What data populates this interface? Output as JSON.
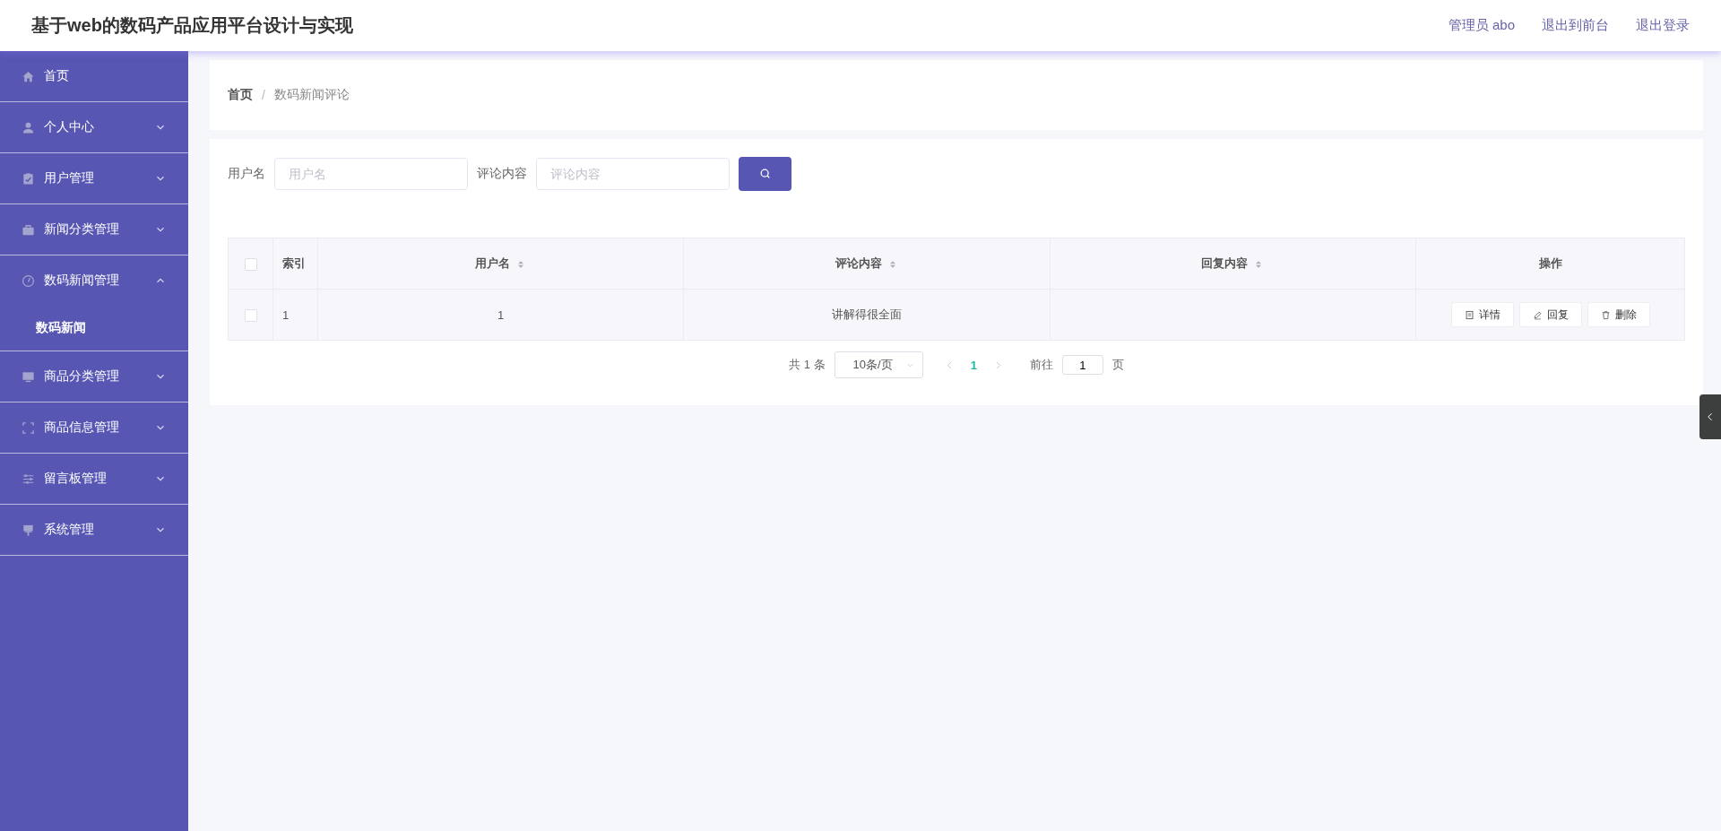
{
  "header": {
    "title": "基于web的数码产品应用平台设计与实现",
    "links": [
      "管理员 abo",
      "退出到前台",
      "退出登录"
    ]
  },
  "sidebar": {
    "items": [
      {
        "kind": "link",
        "label": "首页"
      },
      {
        "kind": "submenu",
        "label": "个人中心",
        "expanded": false
      },
      {
        "kind": "submenu",
        "label": "用户管理",
        "expanded": false
      },
      {
        "kind": "submenu",
        "label": "新闻分类管理",
        "expanded": false
      },
      {
        "kind": "submenu",
        "label": "数码新闻管理",
        "expanded": true,
        "children": [
          {
            "label": "数码新闻"
          }
        ]
      },
      {
        "kind": "submenu",
        "label": "商品分类管理",
        "expanded": false
      },
      {
        "kind": "submenu",
        "label": "商品信息管理",
        "expanded": false
      },
      {
        "kind": "submenu",
        "label": "留言板管理",
        "expanded": false
      },
      {
        "kind": "submenu",
        "label": "系统管理",
        "expanded": false
      }
    ]
  },
  "breadcrumb": {
    "items": [
      "首页",
      "数码新闻评论"
    ],
    "separator": "/"
  },
  "search": {
    "fields": [
      {
        "label": "用户名",
        "placeholder": "用户名"
      },
      {
        "label": "评论内容",
        "placeholder": "评论内容"
      }
    ]
  },
  "table": {
    "select_all_checked": false,
    "columns": [
      {
        "label": "索引",
        "sortable": false
      },
      {
        "label": "用户名",
        "sortable": true
      },
      {
        "label": "评论内容",
        "sortable": true
      },
      {
        "label": "回复内容",
        "sortable": true
      },
      {
        "label": "操作",
        "sortable": false
      }
    ],
    "rows": [
      {
        "checked": false,
        "index": "1",
        "username": "1",
        "comment": "讲解得很全面",
        "actions": [
          "详情",
          "回复",
          "删除"
        ]
      }
    ]
  },
  "pagination": {
    "total": "共 1 条",
    "page_size": "10条/页",
    "pages": [
      {
        "label": "1",
        "selected": true
      }
    ],
    "goto_label": "前往",
    "goto_value": "1",
    "page_unit": "页"
  }
}
